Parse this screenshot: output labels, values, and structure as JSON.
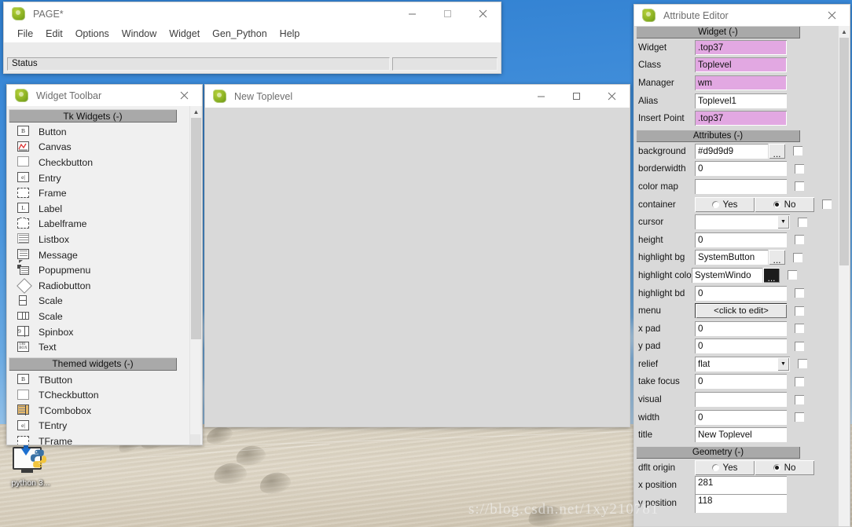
{
  "desktop": {
    "icon": {
      "label": "python 3...",
      "icon": "python-installer-icon"
    },
    "watermark": "s://blog.csdn.net/1xy210781"
  },
  "page_window": {
    "title": "PAGE*",
    "icon": "page-app-icon",
    "controls": {
      "minimize": "–",
      "maximize": "□",
      "close": "✕"
    },
    "menus": [
      "File",
      "Edit",
      "Options",
      "Window",
      "Widget",
      "Gen_Python",
      "Help"
    ],
    "status": {
      "text": "Status",
      "extra": ""
    }
  },
  "toolbar_window": {
    "title": "Widget Toolbar",
    "icon": "page-app-icon",
    "controls": {
      "close": "✕"
    },
    "sections": [
      {
        "header": "Tk Widgets (-)",
        "items": [
          {
            "label": "Button",
            "icon": "button-widget-icon"
          },
          {
            "label": "Canvas",
            "icon": "canvas-widget-icon"
          },
          {
            "label": "Checkbutton",
            "icon": "checkbutton-widget-icon"
          },
          {
            "label": "Entry",
            "icon": "entry-widget-icon"
          },
          {
            "label": "Frame",
            "icon": "frame-widget-icon"
          },
          {
            "label": "Label",
            "icon": "label-widget-icon"
          },
          {
            "label": "Labelframe",
            "icon": "labelframe-widget-icon"
          },
          {
            "label": "Listbox",
            "icon": "listbox-widget-icon"
          },
          {
            "label": "Message",
            "icon": "message-widget-icon"
          },
          {
            "label": "Popupmenu",
            "icon": "popupmenu-widget-icon"
          },
          {
            "label": "Radiobutton",
            "icon": "radiobutton-widget-icon"
          },
          {
            "label": "Scale",
            "icon": "scale-vertical-widget-icon"
          },
          {
            "label": "Scale",
            "icon": "scale-horizontal-widget-icon"
          },
          {
            "label": "Spinbox",
            "icon": "spinbox-widget-icon"
          },
          {
            "label": "Text",
            "icon": "text-widget-icon"
          }
        ]
      },
      {
        "header": "Themed widgets (-)",
        "items": [
          {
            "label": "TButton",
            "icon": "tbutton-widget-icon"
          },
          {
            "label": "TCheckbutton",
            "icon": "tcheckbutton-widget-icon"
          },
          {
            "label": "TCombobox",
            "icon": "tcombobox-widget-icon"
          },
          {
            "label": "TEntry",
            "icon": "tentry-widget-icon"
          },
          {
            "label": "TFrame",
            "icon": "tframe-widget-icon"
          }
        ]
      }
    ]
  },
  "toplevel_window": {
    "title": "New Toplevel",
    "icon": "page-app-icon",
    "controls": {
      "minimize": "–",
      "maximize": "□",
      "close": "✕"
    },
    "canvas_background": "#d9d9d9"
  },
  "attribute_editor": {
    "title": "Attribute Editor",
    "icon": "page-app-icon",
    "controls": {
      "close": "✕"
    },
    "widget_section": {
      "header": "Widget (-)",
      "rows": [
        {
          "label": "Widget",
          "value": ".top37",
          "style": "pink"
        },
        {
          "label": "Class",
          "value": "Toplevel",
          "style": "pink"
        },
        {
          "label": "Manager",
          "value": "wm",
          "style": "pink"
        },
        {
          "label": "Alias",
          "value": "Toplevel1",
          "style": "white"
        },
        {
          "label": "Insert Point",
          "value": ".top37",
          "style": "pink"
        }
      ]
    },
    "attributes_section": {
      "header": "Attributes (-)",
      "rows": [
        {
          "label": "background",
          "value": "#d9d9d9",
          "type": "entry-dots"
        },
        {
          "label": "borderwidth",
          "value": "0",
          "type": "entry"
        },
        {
          "label": "color map",
          "value": "",
          "type": "entry"
        },
        {
          "label": "container",
          "value": "No",
          "type": "radio",
          "options": [
            "Yes",
            "No"
          ]
        },
        {
          "label": "cursor",
          "value": "",
          "type": "combo"
        },
        {
          "label": "height",
          "value": "0",
          "type": "entry"
        },
        {
          "label": "highlight bg",
          "value": "SystemButton",
          "type": "entry-dots"
        },
        {
          "label": "highlight colo",
          "value": "SystemWindo",
          "type": "entry-dots-dark"
        },
        {
          "label": "highlight bd",
          "value": "0",
          "type": "entry"
        },
        {
          "label": "menu",
          "value": "<click to edit>",
          "type": "button"
        },
        {
          "label": "x pad",
          "value": "0",
          "type": "entry"
        },
        {
          "label": "y pad",
          "value": "0",
          "type": "entry"
        },
        {
          "label": "relief",
          "value": "flat",
          "type": "combo"
        },
        {
          "label": "take focus",
          "value": "0",
          "type": "entry"
        },
        {
          "label": "visual",
          "value": "",
          "type": "entry"
        },
        {
          "label": "width",
          "value": "0",
          "type": "entry"
        },
        {
          "label": "title",
          "value": "New Toplevel",
          "type": "entry"
        }
      ]
    },
    "geometry_section": {
      "header": "Geometry (-)",
      "rows": [
        {
          "label": "dflt origin",
          "value": "No",
          "type": "radio",
          "options": [
            "Yes",
            "No"
          ]
        },
        {
          "label": "x position",
          "value": "281",
          "type": "entry"
        },
        {
          "label": "y position",
          "value": "118",
          "type": "entry"
        }
      ]
    }
  },
  "colors": {
    "selected_field": "#e2a8e2",
    "header_bar": "#a9a9a9",
    "window_body": "#d9d9d9",
    "titlebar": "#ffffff"
  }
}
